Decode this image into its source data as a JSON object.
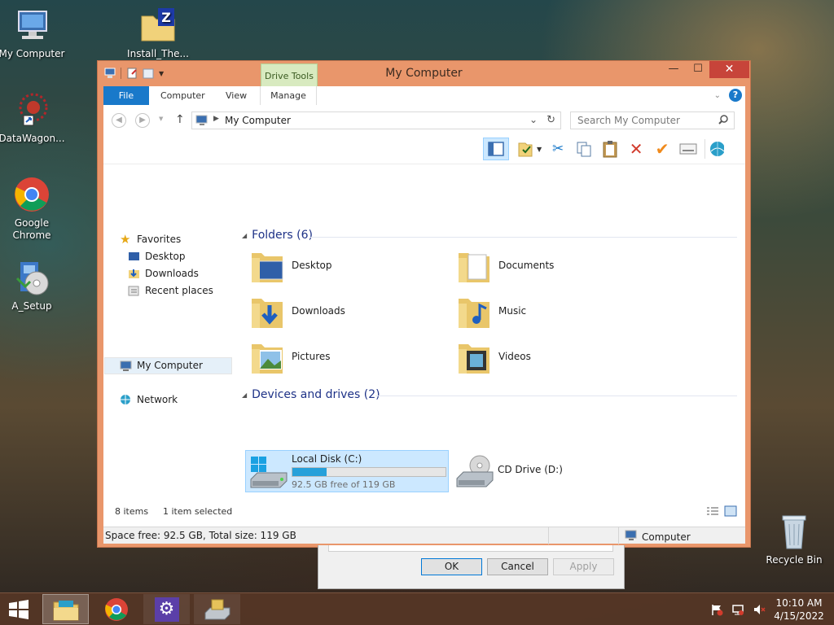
{
  "desktop": {
    "icons": [
      {
        "label": "My Computer"
      },
      {
        "label": "Install_The..."
      },
      {
        "label": "DataWagon..."
      },
      {
        "label": "Google Chrome"
      },
      {
        "label": "A_Setup"
      },
      {
        "label": "Recycle Bin"
      }
    ]
  },
  "window": {
    "title": "My Computer",
    "context_tab": "Drive Tools",
    "tabs": {
      "file": "File",
      "computer": "Computer",
      "view": "View",
      "manage": "Manage"
    },
    "address": "My Computer",
    "search_placeholder": "Search My Computer"
  },
  "nav": {
    "favorites": "Favorites",
    "desktop": "Desktop",
    "downloads": "Downloads",
    "recent": "Recent places",
    "my_computer": "My Computer",
    "network": "Network"
  },
  "main": {
    "folders_head": "Folders (6)",
    "folders": [
      "Desktop",
      "Documents",
      "Downloads",
      "Music",
      "Pictures",
      "Videos"
    ],
    "devices_head": "Devices and drives (2)",
    "drive_c": {
      "name": "Local Disk (C:)",
      "free_text": "92.5 GB free of 119 GB",
      "used_fraction": 0.223
    },
    "drive_d": {
      "name": "CD Drive (D:)"
    }
  },
  "status": {
    "items": "8 items",
    "selected": "1 item selected",
    "space": "Space free: 92.5 GB, Total size: 119 GB",
    "location": "Computer"
  },
  "dialog": {
    "ok": "OK",
    "cancel": "Cancel",
    "apply": "Apply"
  },
  "clock": {
    "time": "10:10 AM",
    "date": "4/15/2022"
  },
  "colors": {
    "window_frame": "#e9966b",
    "file_tab": "#1979ca",
    "selection": "#cce8ff",
    "drive_bar": "#26a0da"
  }
}
